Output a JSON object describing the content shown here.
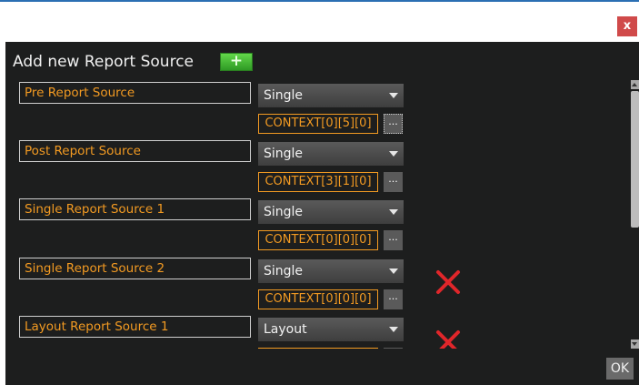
{
  "window": {
    "close_label": "x",
    "accent": "#2b6fb3"
  },
  "dialog": {
    "title": "Add new Report Source",
    "add_label": "+",
    "ok_label": "OK"
  },
  "colors": {
    "panel": "#1d1e1e",
    "orange_text": "#f29a22",
    "delete_red": "#e0262a"
  },
  "sources": [
    {
      "name": "Pre Report Source",
      "type": "Single",
      "context": "CONTEXT[0][5][0]",
      "browse_label": "...",
      "deletable": false
    },
    {
      "name": "Post Report Source",
      "type": "Single",
      "context": "CONTEXT[3][1][0]",
      "browse_label": "...",
      "deletable": false
    },
    {
      "name": "Single Report Source 1",
      "type": "Single",
      "context": "CONTEXT[0][0][0]",
      "browse_label": "...",
      "deletable": false
    },
    {
      "name": "Single Report Source 2",
      "type": "Single",
      "context": "CONTEXT[0][0][0]",
      "browse_label": "...",
      "deletable": true
    },
    {
      "name": "Layout Report Source 1",
      "type": "Layout",
      "context": "",
      "browse_label": "",
      "deletable": true
    }
  ]
}
